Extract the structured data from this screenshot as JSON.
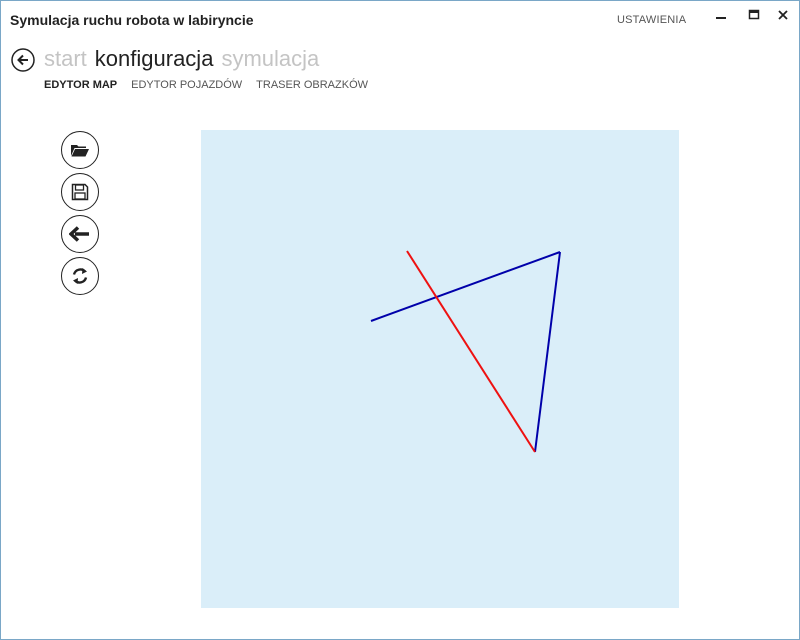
{
  "window": {
    "title": "Symulacja ruchu robota w labiryncie",
    "settings_label": "USTAWIENIA"
  },
  "hub": {
    "sections": [
      "start",
      "konfiguracja",
      "symulacja"
    ],
    "active_section": "konfiguracja"
  },
  "pivot": {
    "tabs": [
      "EDYTOR MAP",
      "EDYTOR POJAZDÓW",
      "TRASER OBRAZKÓW"
    ],
    "active_tab": "EDYTOR MAP"
  },
  "toolbar": {
    "buttons": [
      "open-folder-icon",
      "save-icon",
      "undo-arrow-icon",
      "refresh-icon"
    ]
  },
  "map": {
    "background_color": "#daeef9",
    "wall_colors": [
      "#0000aa",
      "#ee1111"
    ]
  }
}
